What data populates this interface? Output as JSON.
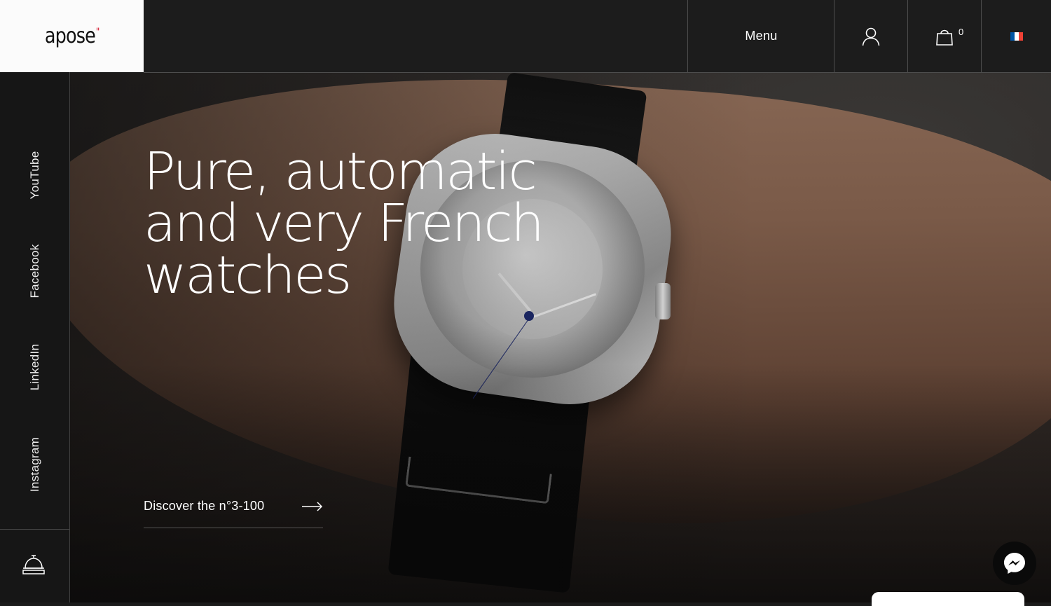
{
  "brand": {
    "logo_text": "apose",
    "logo_mark": "\""
  },
  "header": {
    "menu_label": "Menu",
    "account_icon": "user-icon",
    "cart_icon": "shopping-bag-icon",
    "cart_count": "0",
    "language_icon": "france-flag-icon"
  },
  "social": {
    "items": [
      "YouTube",
      "Facebook",
      "LinkedIn",
      "Instagram"
    ],
    "concierge_icon": "service-bell-icon"
  },
  "hero": {
    "headline_lines": [
      "Pure, automatic",
      "and very French",
      "watches"
    ],
    "cta_label": "Discover the n°3-100",
    "cta_icon": "arrow-right-icon"
  },
  "chat": {
    "icon": "messenger-icon"
  },
  "colors": {
    "logo_mark": "#d0021b",
    "flag_blue": "#0055a4",
    "flag_white": "#ffffff",
    "flag_red": "#ef4135",
    "rail_bg": "#161616"
  }
}
